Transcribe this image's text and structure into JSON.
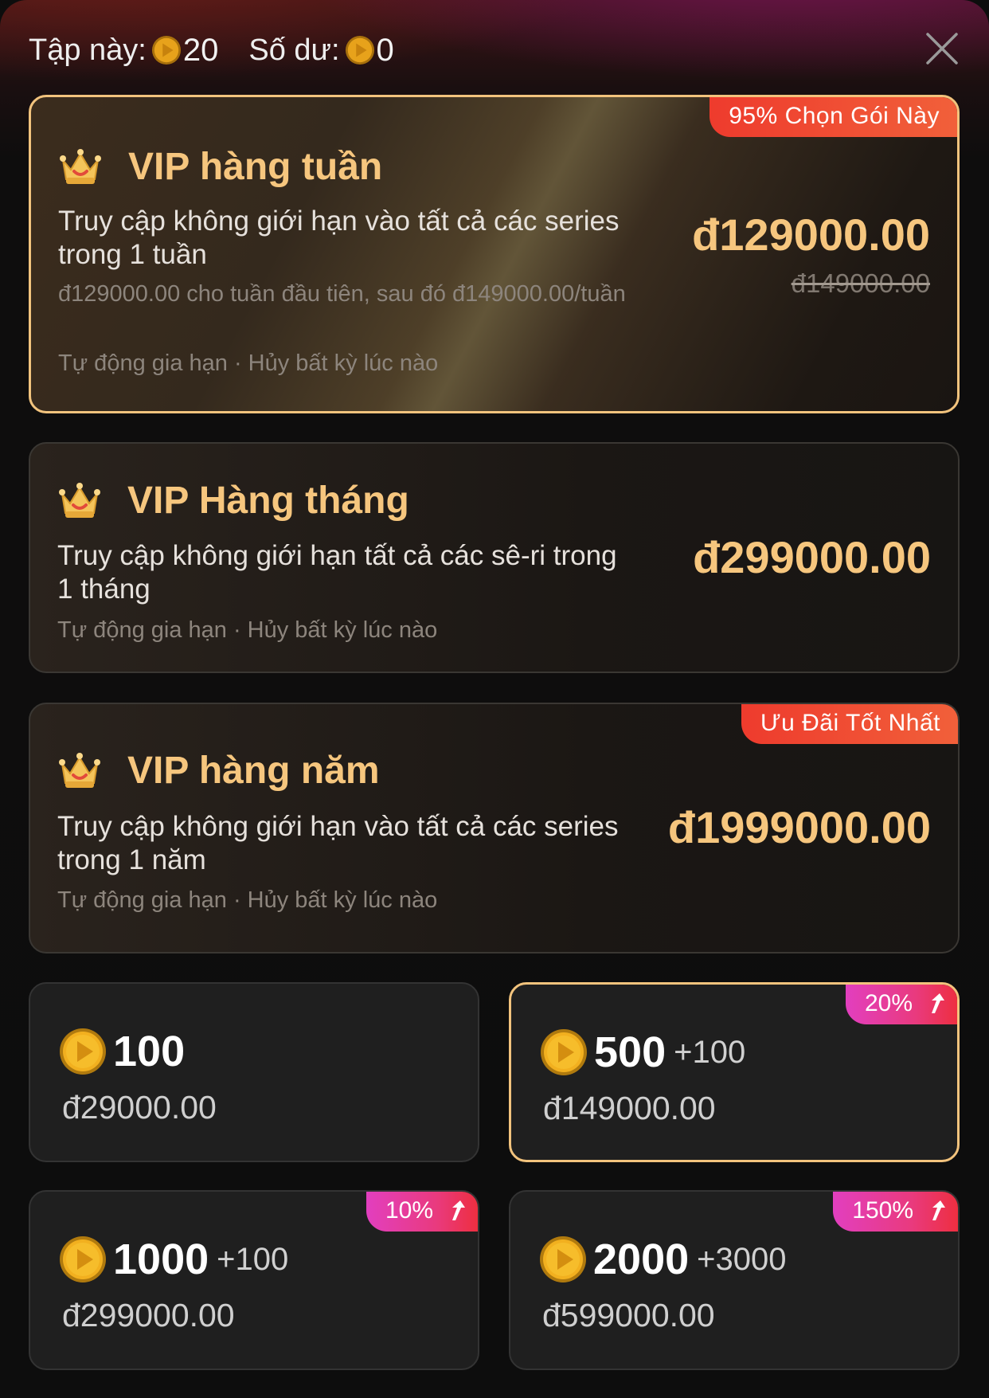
{
  "header": {
    "episode_label": "Tập này:",
    "episode_cost": "20",
    "balance_label": "Số dư:",
    "balance_value": "0"
  },
  "plans": [
    {
      "title": "VIP hàng tuần",
      "description": "Truy cập không giới hạn vào tất cả các series trong 1 tuần",
      "note": "đ129000.00 cho tuần đầu tiên, sau đó đ149000.00/tuần",
      "terms": "Tự động gia hạn · Hủy bất kỳ lúc nào",
      "price": "đ129000.00",
      "old_price": "đ149000.00",
      "badge": "95% Chọn Gói Này",
      "selected": true
    },
    {
      "title": "VIP Hàng tháng",
      "description": "Truy cập không giới hạn tất cả các sê-ri trong 1 tháng",
      "terms": "Tự động gia hạn · Hủy bất kỳ lúc nào",
      "price": "đ299000.00",
      "selected": false
    },
    {
      "title": "VIP hàng năm",
      "description": "Truy cập không giới hạn vào tất cả các series trong 1 năm",
      "terms": "Tự động gia hạn · Hủy bất kỳ lúc nào",
      "price": "đ1999000.00",
      "badge": "Ưu Đãi Tốt Nhất",
      "selected": false
    }
  ],
  "coin_packs": [
    {
      "amount": "100",
      "bonus": "",
      "price": "đ29000.00",
      "badge": "",
      "selected": false
    },
    {
      "amount": "500",
      "bonus": "+100",
      "price": "đ149000.00",
      "badge": "20%",
      "selected": true
    },
    {
      "amount": "1000",
      "bonus": "+100",
      "price": "đ299000.00",
      "badge": "10%",
      "selected": false
    },
    {
      "amount": "2000",
      "bonus": "+3000",
      "price": "đ599000.00",
      "badge": "150%",
      "selected": false
    }
  ],
  "colors": {
    "gold_text": "#f6c67e",
    "selected_border": "#f2c37d",
    "plan_badge": "#ef4a32",
    "pack_badge_start": "#e23fbf",
    "pack_badge_end": "#ee2e3e"
  },
  "icons": {
    "coin": "coin-icon",
    "crown": "crown-icon",
    "close": "close-icon",
    "arrow": "arrow-up-icon"
  }
}
